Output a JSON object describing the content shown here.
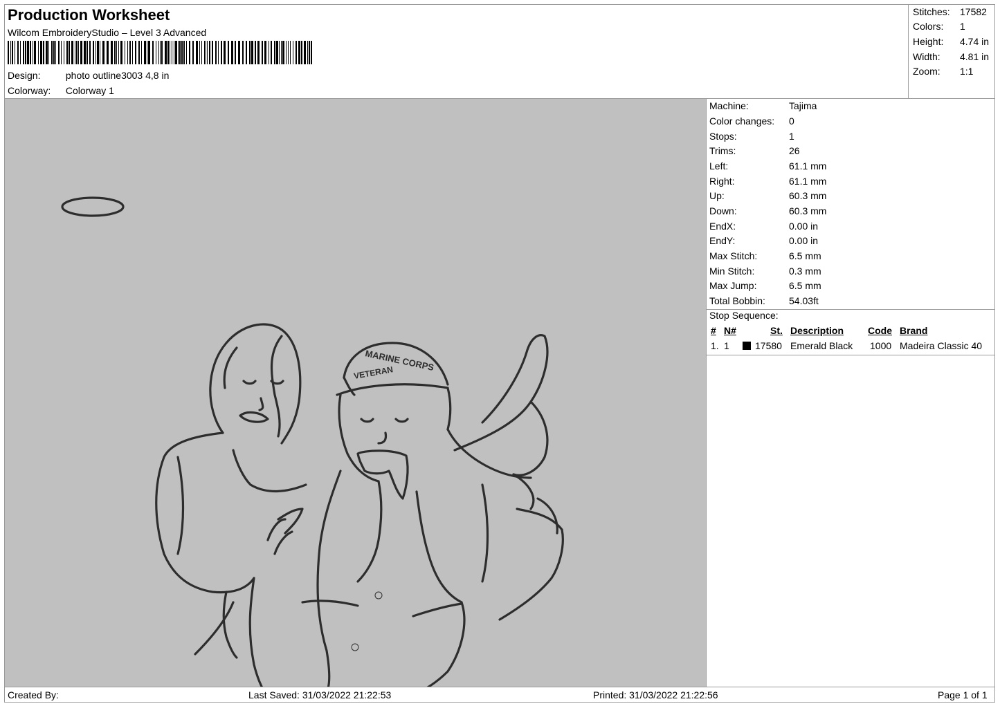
{
  "header": {
    "title": "Production Worksheet",
    "software": "Wilcom EmbroideryStudio – Level 3 Advanced",
    "design_label": "Design:",
    "design_value": "photo outline3003 4,8 in",
    "colorway_label": "Colorway:",
    "colorway_value": "Colorway 1"
  },
  "summary": [
    {
      "label": "Stitches:",
      "value": "17582"
    },
    {
      "label": "Colors:",
      "value": "1"
    },
    {
      "label": "Height:",
      "value": "4.74 in"
    },
    {
      "label": "Width:",
      "value": "4.81 in"
    },
    {
      "label": "Zoom:",
      "value": "1:1"
    }
  ],
  "machine_info": [
    {
      "label": "Machine:",
      "value": "Tajima"
    },
    {
      "label": "Color changes:",
      "value": "0"
    },
    {
      "label": "Stops:",
      "value": "1"
    },
    {
      "label": "Trims:",
      "value": "26"
    },
    {
      "label": "Left:",
      "value": "61.1 mm"
    },
    {
      "label": "Right:",
      "value": "61.1 mm"
    },
    {
      "label": "Up:",
      "value": "60.3 mm"
    },
    {
      "label": "Down:",
      "value": "60.3 mm"
    },
    {
      "label": "EndX:",
      "value": "0.00 in"
    },
    {
      "label": "EndY:",
      "value": "0.00 in"
    },
    {
      "label": "Max Stitch:",
      "value": "6.5 mm"
    },
    {
      "label": "Min Stitch:",
      "value": "0.3 mm"
    },
    {
      "label": "Max Jump:",
      "value": "6.5 mm"
    },
    {
      "label": "Total Bobbin:",
      "value": "54.03ft"
    }
  ],
  "stop_sequence": {
    "title": "Stop Sequence:",
    "columns": [
      "#",
      "N#",
      "St.",
      "Description",
      "Code",
      "Brand"
    ],
    "rows": [
      {
        "index": "1.",
        "needle": "1",
        "color": "#000000",
        "stitches": "17580",
        "description": "Emerald Black",
        "code": "1000",
        "brand": "Madeira Classic 40"
      }
    ]
  },
  "footer": {
    "created_by": "Created By:",
    "last_saved": "Last Saved: 31/03/2022 21:22:53",
    "printed": "Printed: 31/03/2022 21:22:56",
    "page": "Page 1 of 1"
  },
  "design_preview": {
    "background": "#c0c0c0",
    "thread_color": "#2d2d2d",
    "cap_text_top": "MARINE CORPS",
    "cap_text_bottom": "VETERAN"
  }
}
